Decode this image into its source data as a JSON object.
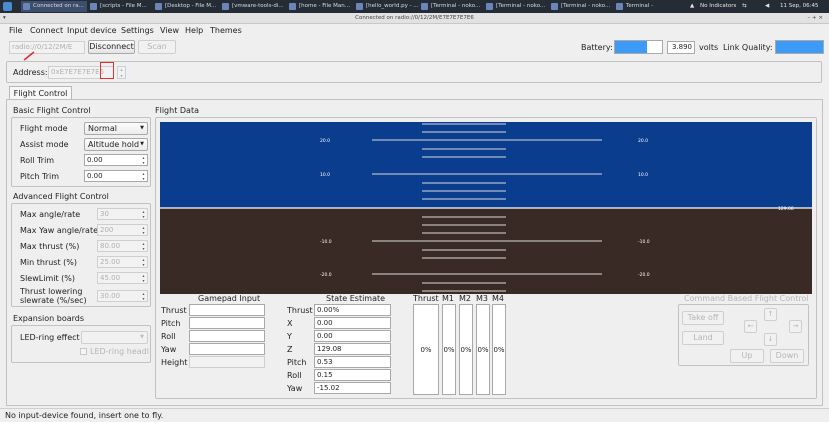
{
  "taskbar": {
    "items": [
      "Connected on ra...",
      "[scripts - File M...",
      "[Desktop - File M...",
      "[vmware-tools-di...",
      "[home - File Man...",
      "[hello_world.py - ...",
      "[Terminal - noko...",
      "[Terminal - noko...",
      "[Terminal - noko...",
      "Terminal -"
    ],
    "indicators": "No Indicators",
    "clock": "11 Sep, 06:45"
  },
  "window": {
    "title": "Connected on radio://0/12/2M/E7E7E7E7E6",
    "controls": "– + ×"
  },
  "menubar": [
    "File",
    "Connect",
    "Input device",
    "Settings",
    "View",
    "Help",
    "Themes"
  ],
  "toolbar": {
    "uri": "radio://0/12/2M/E",
    "disconnect": "Disconnect",
    "scan": "Scan",
    "battery_label": "Battery:",
    "battery_fill": 0.69,
    "voltage": "3.890",
    "volts_label": "volts",
    "link_label": "Link Quality:",
    "link_fill": 1.0,
    "address_label": "Address:",
    "address_value": "0xE7E7E7E7E6",
    "address_highlight": "E6"
  },
  "tabs": [
    "Flight Control"
  ],
  "basic": {
    "title": "Basic Flight Control",
    "flight_mode_label": "Flight mode",
    "flight_mode_value": "Normal",
    "assist_mode_label": "Assist mode",
    "assist_mode_value": "Altitude hold",
    "roll_trim_label": "Roll Trim",
    "roll_trim_value": "0.00",
    "pitch_trim_label": "Pitch Trim",
    "pitch_trim_value": "0.00"
  },
  "advanced": {
    "title": "Advanced Flight Control",
    "rows": [
      {
        "label": "Max angle/rate",
        "value": "30"
      },
      {
        "label": "Max Yaw angle/rate",
        "value": "200"
      },
      {
        "label": "Max thrust (%)",
        "value": "80.00"
      },
      {
        "label": "Min thrust (%)",
        "value": "25.00"
      },
      {
        "label": "SlewLimit (%)",
        "value": "45.00"
      },
      {
        "label": "Thrust lowering slewrate (%/sec)",
        "value": "30.00"
      }
    ]
  },
  "expansion": {
    "title": "Expansion boards",
    "led_label": "LED-ring effect",
    "led_head": "LED-ring headl"
  },
  "flight_data": {
    "title": "Flight Data",
    "sky_color": "#0b3d8f",
    "ground_color": "#3a2a25",
    "pitch_labels": [
      "20.0",
      "10.0",
      "-10.0",
      "-20.0"
    ],
    "altitude": "129.08"
  },
  "gamepad": {
    "title": "Gamepad Input",
    "labels": [
      "Thrust",
      "Pitch",
      "Roll",
      "Yaw",
      "Height"
    ]
  },
  "state": {
    "title": "State Estimate",
    "rows": [
      {
        "label": "Thrust",
        "value": "0.00%"
      },
      {
        "label": "X",
        "value": "0.00"
      },
      {
        "label": "Y",
        "value": "0.00"
      },
      {
        "label": "Z",
        "value": "129.08"
      },
      {
        "label": "Pitch",
        "value": "0.53"
      },
      {
        "label": "Roll",
        "value": "0.15"
      },
      {
        "label": "Yaw",
        "value": "-15.02"
      }
    ]
  },
  "motors": {
    "headers": [
      "Thrust",
      "M1",
      "M2",
      "M3",
      "M4"
    ],
    "values": [
      "0%",
      "0%",
      "0%",
      "0%",
      "0%"
    ]
  },
  "command": {
    "title": "Command Based Flight Control",
    "takeoff": "Take off",
    "land": "Land",
    "up": "Up",
    "down": "Down",
    "arrow_up": "↑",
    "arrow_down": "↓",
    "arrow_left": "←",
    "arrow_right": "→"
  },
  "status": "No input-device found, insert one to fly."
}
